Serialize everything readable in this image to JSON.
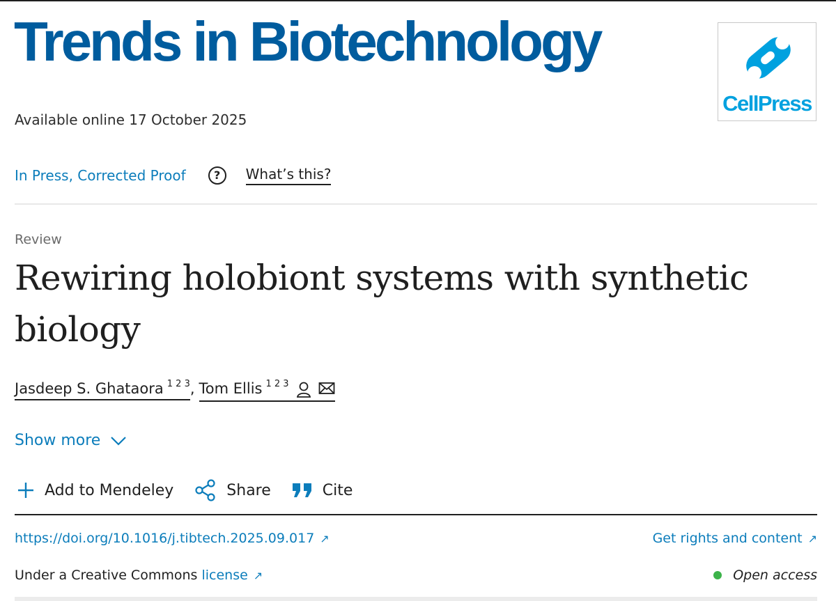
{
  "journal": {
    "title": "Trends in Biotechnology",
    "publisher": "CellPress",
    "publisher_color": "#00a1df",
    "title_color": "#005c9e"
  },
  "article": {
    "available_online": "Available online 17 October 2025",
    "status_link": "In Press, Corrected Proof",
    "help_icon": "question-circle-icon",
    "whats_this": "What’s this?",
    "type": "Review",
    "title": "Rewiring holobiont systems with synthetic biology",
    "authors": [
      {
        "name": "Jasdeep S. Ghataora",
        "affiliations": "1 2 3"
      },
      {
        "name": "Tom Ellis",
        "affiliations": "1 2 3",
        "icons": [
          "person-icon",
          "mail-icon"
        ]
      }
    ],
    "author_separator": ","
  },
  "show_more": {
    "label": "Show more",
    "icon": "chevron-down-icon"
  },
  "actions": [
    {
      "label": "Add to Mendeley",
      "icon": "plus-icon"
    },
    {
      "label": "Share",
      "icon": "share-icon"
    },
    {
      "label": "Cite",
      "icon": "quote-icon"
    }
  ],
  "links": {
    "doi": "https://doi.org/10.1016/j.tibtech.2025.09.017",
    "rights": "Get rights and content",
    "external_arrow": "↗",
    "license_prefix": "Under a Creative Commons",
    "license_link": "license",
    "open_access": "Open access",
    "open_access_color": "#3cb34a",
    "link_color": "#0c7dbb"
  }
}
